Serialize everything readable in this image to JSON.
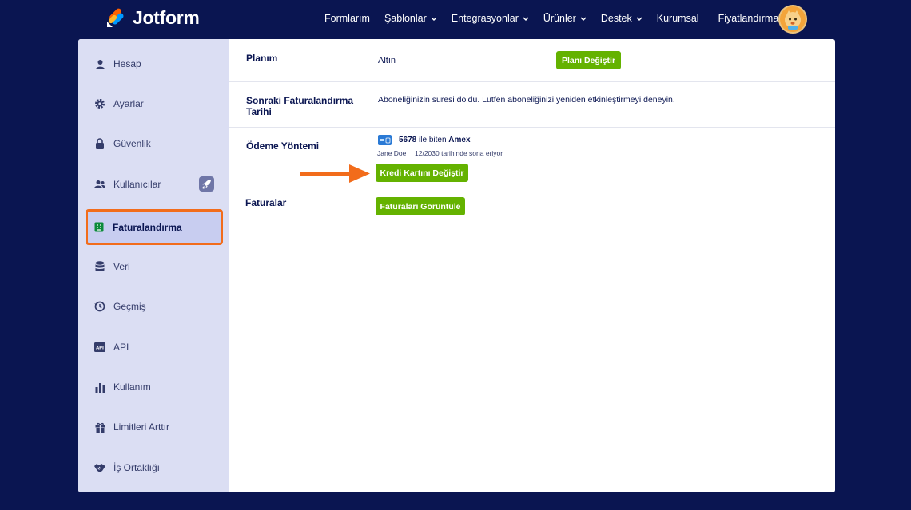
{
  "brand": {
    "name": "Jotform"
  },
  "nav": {
    "items": [
      {
        "label": "Formlarım",
        "has_chevron": false
      },
      {
        "label": "Şablonlar",
        "has_chevron": true
      },
      {
        "label": "Entegrasyonlar",
        "has_chevron": true
      },
      {
        "label": "Ürünler",
        "has_chevron": true
      },
      {
        "label": "Destek",
        "has_chevron": true
      },
      {
        "label": "Kurumsal",
        "has_chevron": false
      },
      {
        "label": "Fiyatlandırma",
        "has_chevron": false
      }
    ],
    "chevron_glyph": "⌄"
  },
  "sidebar": {
    "items": [
      {
        "label": "Hesap",
        "icon": "user-icon"
      },
      {
        "label": "Ayarlar",
        "icon": "gear-icon"
      },
      {
        "label": "Güvenlik",
        "icon": "lock-icon"
      },
      {
        "label": "Kullanıcılar",
        "icon": "users-icon"
      },
      {
        "label": "Faturalandırma",
        "icon": "billing-icon",
        "active": true
      },
      {
        "label": "Veri",
        "icon": "database-icon"
      },
      {
        "label": "Geçmiş",
        "icon": "history-icon"
      },
      {
        "label": "API",
        "icon": "api-icon"
      },
      {
        "label": "Kullanım",
        "icon": "chart-icon"
      },
      {
        "label": "Limitleri Arttır",
        "icon": "gift-icon"
      },
      {
        "label": "İş Ortaklığı",
        "icon": "handshake-icon"
      }
    ]
  },
  "billing": {
    "plan": {
      "label": "Planım",
      "value": "Altın",
      "button": "Planı Değiştir"
    },
    "next_billing": {
      "label_line1": "Sonraki Faturalandırma",
      "label_line2": "Tarihi",
      "value": "Aboneliğinizin süresi doldu. Lütfen aboneliğinizi yeniden etkinleştirmeyi deneyin."
    },
    "payment": {
      "label": "Ödeme Yöntemi",
      "card_last4": "5678",
      "ending_text": "ile biten",
      "card_brand": "Amex",
      "holder": "Jane Doe",
      "expiry_text": "12/2030 tarihinde sona eriyor",
      "button": "Kredi Kartını Değiştir"
    },
    "invoices": {
      "label": "Faturalar",
      "button": "Faturaları Görüntüle"
    }
  },
  "colors": {
    "background": "#0a1551",
    "accent_green": "#64b200",
    "highlight_orange": "#f26c1b",
    "sidebar_bg": "#dbdef3"
  }
}
